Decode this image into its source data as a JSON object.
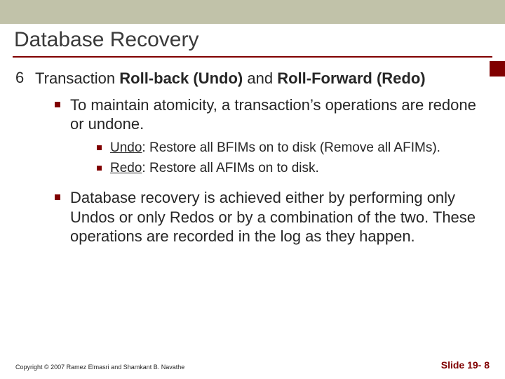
{
  "title": "Database Recovery",
  "item_number": "6",
  "item_heading_pre": "Transaction ",
  "item_heading_b1": "Roll-back (Undo)",
  "item_heading_mid": " and ",
  "item_heading_b2": "Roll-Forward (Redo)",
  "lvl1_a": "To maintain atomicity, a transaction’s operations are redone or undone.",
  "lvl2_a_u": "Undo",
  "lvl2_a_rest": ": Restore all BFIMs on to disk (Remove all AFIMs).",
  "lvl2_b_u": "Redo",
  "lvl2_b_rest": ": Restore all AFIMs on to disk.",
  "lvl1_b": "Database recovery is achieved either by performing only Undos or only Redos or by a combination of the two. These operations are recorded in the log as they happen.",
  "copyright": "Copyright © 2007 Ramez Elmasri and Shamkant B. Navathe",
  "slide_no": "Slide 19- 8"
}
